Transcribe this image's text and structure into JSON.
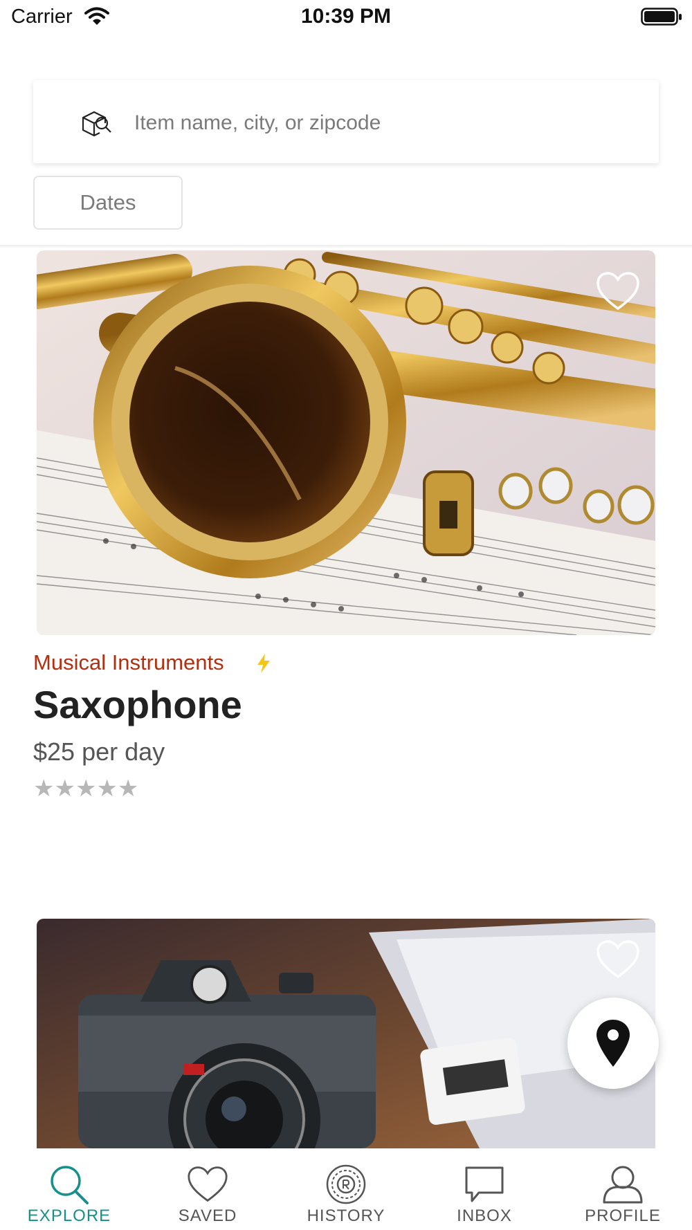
{
  "status_bar": {
    "carrier": "Carrier",
    "time": "10:39 PM"
  },
  "search": {
    "placeholder": "Item name, city, or zipcode",
    "icon": "box-search-icon"
  },
  "filters": {
    "dates_label": "Dates"
  },
  "listings": [
    {
      "category": "Musical Instruments",
      "instant_book_icon": "lightning-bolt-icon",
      "title": "Saxophone",
      "price": "$25 per day",
      "rating_stars": 5,
      "rating_display": "★★★★★",
      "image": "saxophone-photo",
      "favorite_icon": "heart-outline-icon"
    },
    {
      "image": "camera-photo",
      "favorite_icon": "heart-outline-icon"
    }
  ],
  "map_button": {
    "icon": "map-pin-icon"
  },
  "tabs": [
    {
      "label": "EXPLORE",
      "icon": "search-icon",
      "active": true
    },
    {
      "label": "SAVED",
      "icon": "heart-icon",
      "active": false
    },
    {
      "label": "HISTORY",
      "icon": "history-badge-icon",
      "active": false
    },
    {
      "label": "INBOX",
      "icon": "chat-bubble-icon",
      "active": false
    },
    {
      "label": "PROFILE",
      "icon": "person-icon",
      "active": false
    }
  ],
  "colors": {
    "accent": "#15908a",
    "category": "#b2300f",
    "bolt": "#f5c518",
    "star": "#b7b7b7"
  }
}
